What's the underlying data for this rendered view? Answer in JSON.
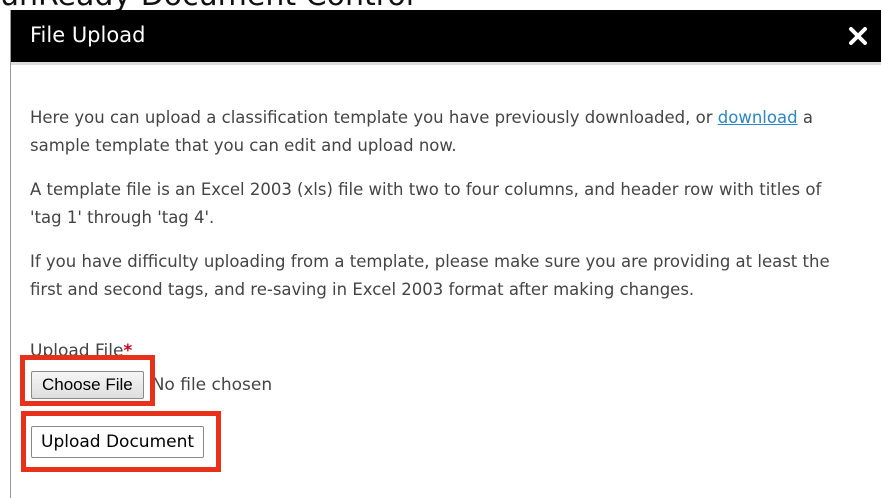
{
  "background": {
    "caption": "unReady Document Control"
  },
  "dialog": {
    "title": "File Upload",
    "close_icon": "close-icon",
    "intro_before_link": "Here you can upload a classification template you have previously downloaded, or ",
    "intro_link": "download",
    "intro_after_link": " a sample template that you can edit and upload now.",
    "paragraph_2": "A template file is an Excel 2003 (xls) file with two to four columns, and header row with titles of 'tag 1' through 'tag 4'.",
    "paragraph_3": "If you have difficulty uploading from a template, please make sure you are providing at least the first and second tags, and re-saving in Excel 2003 format after making changes.",
    "upload_label": "Upload File",
    "required_marker": "*",
    "choose_file_label": "Choose File",
    "no_file_text": "No file chosen",
    "upload_button_label": "Upload Document"
  },
  "colors": {
    "titlebar": "#000000",
    "link": "#2a87c8",
    "highlight": "#e8301b",
    "required": "#d0021b"
  }
}
